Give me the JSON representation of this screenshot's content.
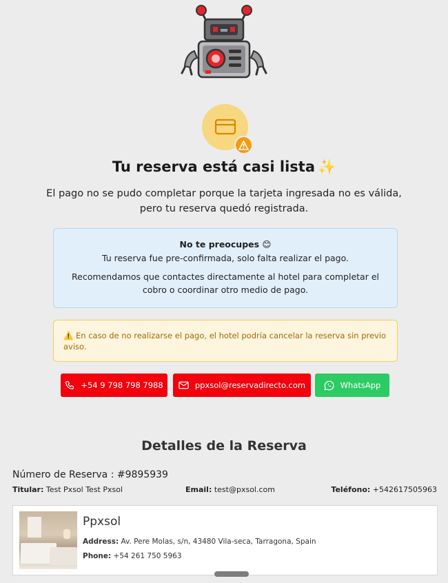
{
  "header": {
    "robot_icon": "robot-mascot-icon",
    "payment_icon": "credit-card-icon",
    "warning_badge_icon": "warning-triangle-icon",
    "title": "Tu reserva está casi lista",
    "title_emoji": "✨",
    "subtitle_line1": "El pago no se pudo completar porque la tarjeta ingresada no es válida,",
    "subtitle_line2": "pero tu reserva quedó registrada."
  },
  "info_box": {
    "title": "No te preocupes 😊",
    "line1": "Tu reserva fue pre-confirmada, solo falta realizar el pago.",
    "line2": "Recomendamos que contactes directamente al hotel para completar el cobro o coordinar otro medio de pago."
  },
  "warning_box": {
    "icon": "⚠️",
    "text": "En caso de no realizarse el pago, el hotel podría cancelar la reserva sin previo aviso."
  },
  "contact_buttons": {
    "phone_label": "+54 9 798 798 7988",
    "email_label": "ppxsol@reservadirecto.com",
    "whatsapp_label": "WhatsApp"
  },
  "details": {
    "section_title": "Detalles de la Reserva",
    "reservation_number": "Número de Reserva : #9895939",
    "titular_label": "Titular:",
    "titular_value": "Test Pxsol Test Pxsol",
    "email_label": "Email:",
    "email_value": "test@pxsol.com",
    "phone_label": "Teléfono:",
    "phone_value": "+542617505963"
  },
  "hotel": {
    "name": "Ppxsol",
    "address_label": "Address:",
    "address_value": "Av. Pere Molas, s/n, 43480 Vila-seca, Tarragona, Spain",
    "phone_label": "Phone:",
    "phone_value": "+54 261 750 5963"
  },
  "colors": {
    "background": "#ececec",
    "danger": "#f2020c",
    "whatsapp": "#2ccb63",
    "info_bg": "#e1effb",
    "warning_bg": "#fdf5de",
    "warning_text": "#a46a00"
  }
}
